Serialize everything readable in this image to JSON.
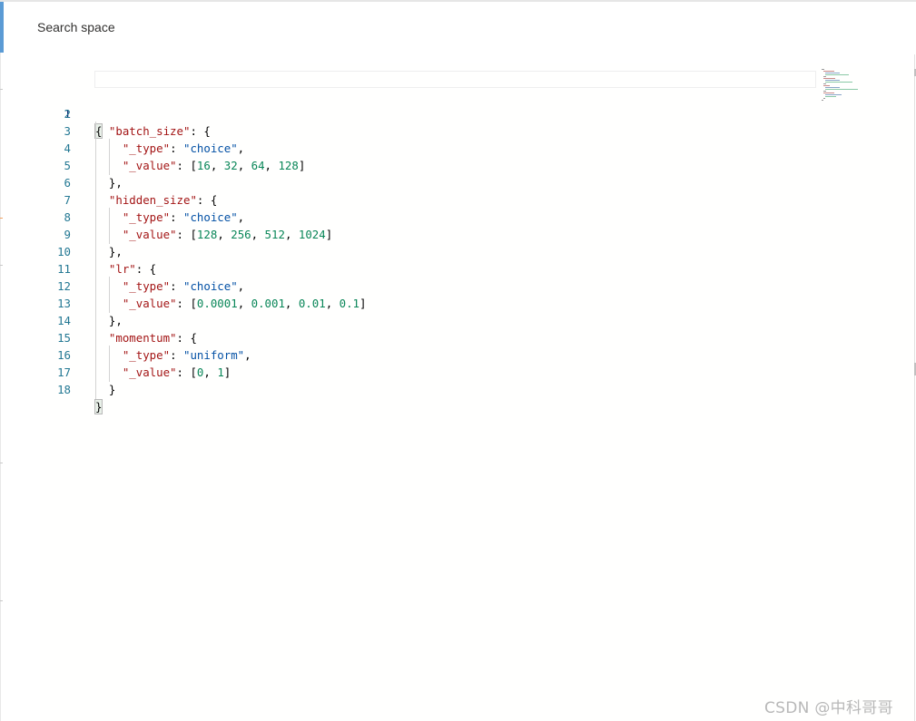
{
  "panel": {
    "title": "Search space"
  },
  "editor": {
    "lines": [
      {
        "n": "1"
      },
      {
        "n": "2",
        "key": "\"batch_size\""
      },
      {
        "n": "3",
        "key": "\"_type\"",
        "val": "\"choice\""
      },
      {
        "n": "4",
        "key": "\"_value\"",
        "nums": [
          "16",
          "32",
          "64",
          "128"
        ]
      },
      {
        "n": "5"
      },
      {
        "n": "6",
        "key": "\"hidden_size\""
      },
      {
        "n": "7",
        "key": "\"_type\"",
        "val": "\"choice\""
      },
      {
        "n": "8",
        "key": "\"_value\"",
        "nums": [
          "128",
          "256",
          "512",
          "1024"
        ]
      },
      {
        "n": "9"
      },
      {
        "n": "10",
        "key": "\"lr\""
      },
      {
        "n": "11",
        "key": "\"_type\"",
        "val": "\"choice\""
      },
      {
        "n": "12",
        "key": "\"_value\"",
        "nums": [
          "0.0001",
          "0.001",
          "0.01",
          "0.1"
        ]
      },
      {
        "n": "13"
      },
      {
        "n": "14",
        "key": "\"momentum\""
      },
      {
        "n": "15",
        "key": "\"_type\"",
        "val": "\"uniform\""
      },
      {
        "n": "16",
        "key": "\"_value\"",
        "nums": [
          "0",
          "1"
        ]
      },
      {
        "n": "17"
      },
      {
        "n": "18"
      }
    ]
  },
  "colors": {
    "key": "#a31515",
    "string": "#0451a5",
    "number": "#098658",
    "line_number": "#237893",
    "accent": "#5b9bd5"
  },
  "watermark": "CSDN @中科哥哥"
}
